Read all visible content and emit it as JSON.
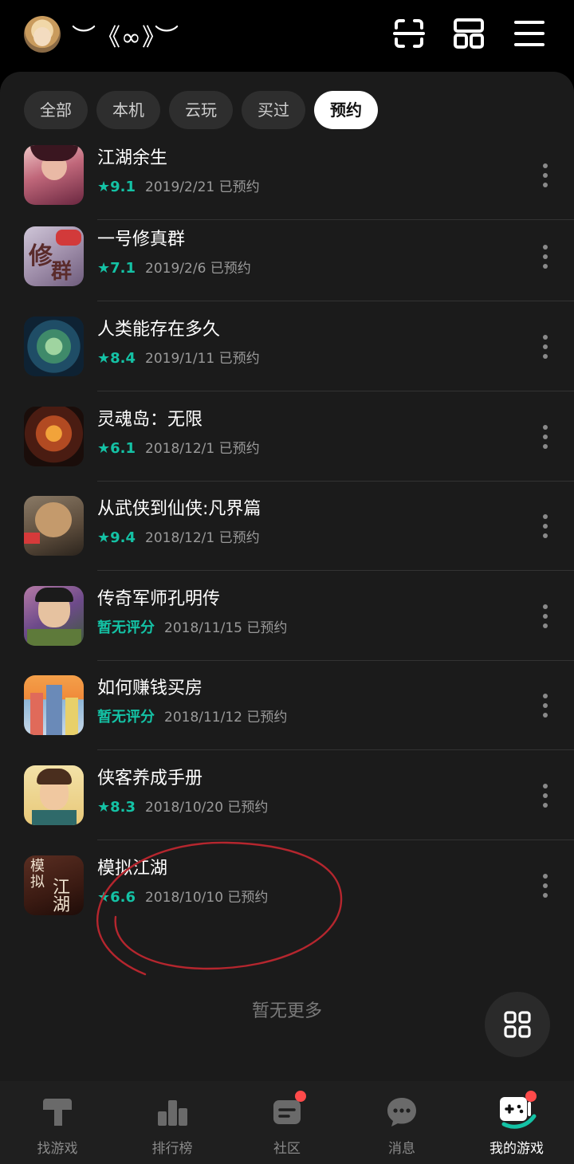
{
  "header": {
    "nickname": "︶《∞》︶",
    "icons": [
      "scan-icon",
      "grid-icon",
      "menu-icon"
    ]
  },
  "filters": {
    "tabs": [
      {
        "label": "全部",
        "active": false
      },
      {
        "label": "本机",
        "active": false
      },
      {
        "label": "云玩",
        "active": false
      },
      {
        "label": "买过",
        "active": false
      },
      {
        "label": "预约",
        "active": true
      }
    ]
  },
  "games": [
    {
      "name": "江湖余生",
      "rating": "★9.1",
      "date": "2019/2/21 已预约"
    },
    {
      "name": "一号修真群",
      "rating": "★7.1",
      "date": "2019/2/6 已预约"
    },
    {
      "name": "人类能存在多久",
      "rating": "★8.4",
      "date": "2019/1/11 已预约"
    },
    {
      "name": "灵魂岛：无限",
      "rating": "★6.1",
      "date": "2018/12/1 已预约"
    },
    {
      "name": "从武侠到仙侠:凡界篇",
      "rating": "★9.4",
      "date": "2018/12/1 已预约"
    },
    {
      "name": "传奇军师孔明传",
      "rating": "暂无评分",
      "date": "2018/11/15 已预约"
    },
    {
      "name": "如何赚钱买房",
      "rating": "暂无评分",
      "date": "2018/11/12 已预约"
    },
    {
      "name": "侠客养成手册",
      "rating": "★8.3",
      "date": "2018/10/20 已预约"
    },
    {
      "name": "模拟江湖",
      "rating": "★6.6",
      "date": "2018/10/10 已预约"
    }
  ],
  "footer_text": "暂无更多",
  "accent_color": "#14c2a5",
  "annotation_color": "#b5262e",
  "bottom_nav": [
    {
      "label": "找游戏",
      "icon": "find-games-icon",
      "active": false,
      "badge": false
    },
    {
      "label": "排行榜",
      "icon": "leaderboard-icon",
      "active": false,
      "badge": false
    },
    {
      "label": "社区",
      "icon": "community-icon",
      "active": false,
      "badge": true
    },
    {
      "label": "消息",
      "icon": "messages-icon",
      "active": false,
      "badge": false
    },
    {
      "label": "我的游戏",
      "icon": "my-games-icon",
      "active": true,
      "badge": true
    }
  ]
}
